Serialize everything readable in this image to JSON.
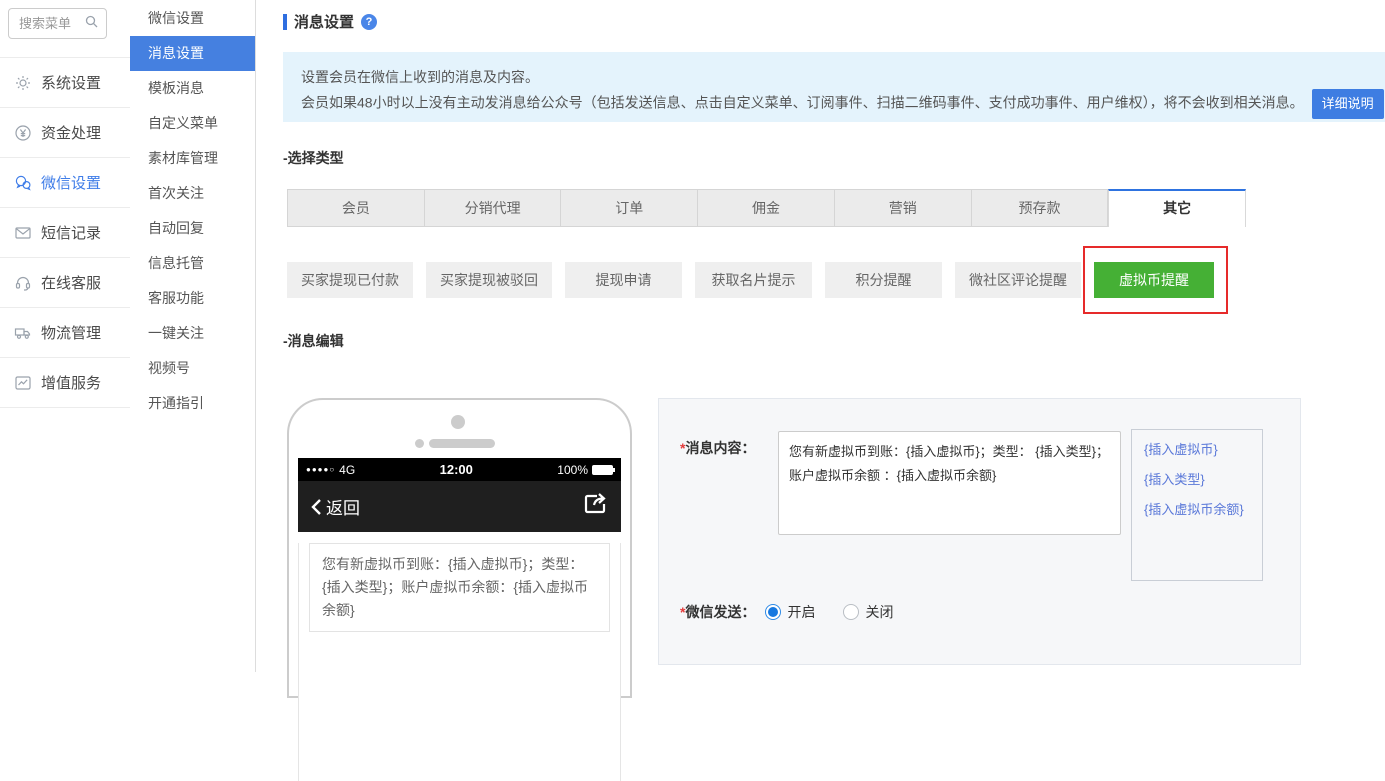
{
  "colors": {
    "accent_blue": "#4580e0",
    "title_bar_blue": "#2e6ee0",
    "notice_bg": "#e4f3fc",
    "active_green": "#45b035",
    "annotation_red": "#e62a2a",
    "tab_gray": "#ebebeb"
  },
  "sidebar": {
    "search_placeholder": "搜索菜单",
    "search_icon": "search-icon",
    "items": [
      {
        "label": "系统设置",
        "icon": "gear-icon",
        "active": false
      },
      {
        "label": "资金处理",
        "icon": "yen-circle-icon",
        "active": false
      },
      {
        "label": "微信设置",
        "icon": "wechat-icon",
        "active": true
      },
      {
        "label": "短信记录",
        "icon": "envelope-icon",
        "active": false
      },
      {
        "label": "在线客服",
        "icon": "headset-icon",
        "active": false
      },
      {
        "label": "物流管理",
        "icon": "truck-icon",
        "active": false
      },
      {
        "label": "增值服务",
        "icon": "chart-icon",
        "active": false
      }
    ]
  },
  "submenu": {
    "items": [
      {
        "label": "微信设置",
        "active": false
      },
      {
        "label": "消息设置",
        "active": true
      },
      {
        "label": "模板消息",
        "active": false
      },
      {
        "label": "自定义菜单",
        "active": false
      },
      {
        "label": "素材库管理",
        "active": false
      },
      {
        "label": "首次关注",
        "active": false
      },
      {
        "label": "自动回复",
        "active": false
      },
      {
        "label": "信息托管",
        "active": false
      },
      {
        "label": "客服功能",
        "active": false
      },
      {
        "label": "一键关注",
        "active": false
      },
      {
        "label": "视频号",
        "active": false
      },
      {
        "label": "开通指引",
        "active": false
      }
    ]
  },
  "main": {
    "title": "消息设置",
    "help_icon": "?",
    "notice": {
      "line1": "设置会员在微信上收到的消息及内容。",
      "line2": "会员如果48小时以上没有主动发消息给公众号（包括发送信息、点击自定义菜单、订阅事件、扫描二维码事件、支付成功事件、用户维权），将不会收到相关消息。",
      "button_label": "详细说明"
    },
    "select_type_label": "-选择类型",
    "tabs": [
      {
        "label": "会员",
        "active": false
      },
      {
        "label": "分销代理",
        "active": false
      },
      {
        "label": "订单",
        "active": false
      },
      {
        "label": "佣金",
        "active": false
      },
      {
        "label": "营销",
        "active": false
      },
      {
        "label": "预存款",
        "active": false
      },
      {
        "label": "其它",
        "active": true
      }
    ],
    "subtypes": [
      {
        "label": "买家提现已付款",
        "active": false
      },
      {
        "label": "买家提现被驳回",
        "active": false
      },
      {
        "label": "提现申请",
        "active": false
      },
      {
        "label": "获取名片提示",
        "active": false
      },
      {
        "label": "积分提醒",
        "active": false
      },
      {
        "label": "微社区评论提醒",
        "active": false
      },
      {
        "label": "虚拟币提醒",
        "active": true,
        "annotated": true
      }
    ],
    "edit_section_label": "-消息编辑",
    "phone": {
      "carrier_dots": "●●●●○",
      "network": "4G",
      "time": "12:00",
      "battery": "100%",
      "back_label": "返回",
      "share_icon": "share-icon",
      "preview_text": "您有新虚拟币到账：{插入虚拟币}；类型：{插入类型}；账户虚拟币余额：{插入虚拟币余额}"
    },
    "form": {
      "required_mark": "*",
      "content_label": "消息内容：",
      "content_value": "您有新虚拟币到账：{插入虚拟币}；类型： {插入类型}；账户虚拟币余额 ：{插入虚拟币余额}",
      "insert_links": [
        "{插入虚拟币}",
        "{插入类型}",
        "{插入虚拟币余额}"
      ],
      "send_label": "微信发送：",
      "radio_on": "开启",
      "radio_off": "关闭",
      "selected": "开启"
    }
  }
}
